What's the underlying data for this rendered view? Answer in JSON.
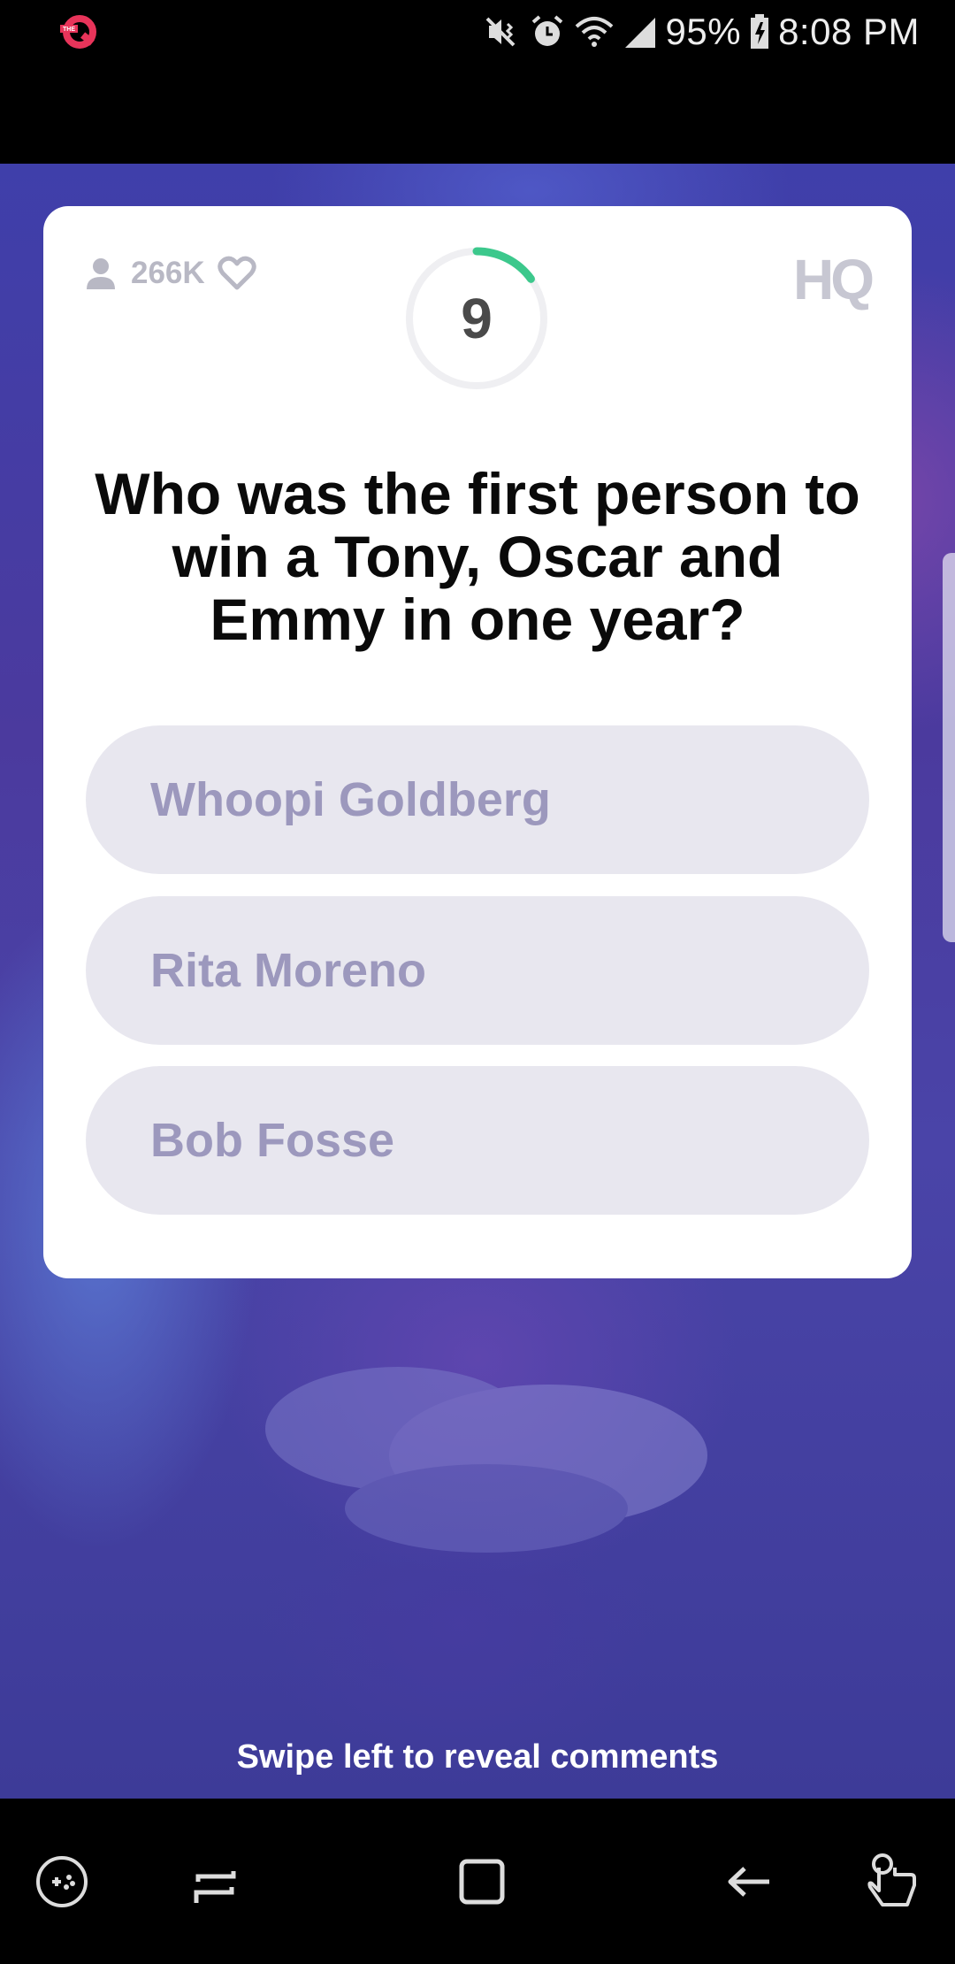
{
  "status_bar": {
    "battery_percent": "95%",
    "time": "8:08 PM",
    "icons": [
      "app-q-icon",
      "mute-vibrate-icon",
      "alarm-icon",
      "wifi-icon",
      "signal-icon",
      "battery-charging-icon"
    ]
  },
  "card": {
    "viewer_count": "266K",
    "timer_value": "9",
    "timer_progress": 0.15,
    "logo_text": "HQ",
    "question": "Who was the first person to win a Tony, Oscar and Emmy in one year?",
    "answers": [
      {
        "label": "Whoopi Goldberg"
      },
      {
        "label": "Rita Moreno"
      },
      {
        "label": "Bob Fosse"
      }
    ]
  },
  "swipe_hint": "Swipe left to reveal comments",
  "nav_bar": {
    "icons": [
      "game-tools-icon",
      "recent-apps-icon",
      "home-icon",
      "back-icon",
      "touch-gesture-icon"
    ]
  },
  "colors": {
    "accent_timer": "#3cc88c",
    "answer_bg": "#e8e7ef",
    "answer_text": "#9c98bd",
    "app_icon": "#e8345a"
  }
}
